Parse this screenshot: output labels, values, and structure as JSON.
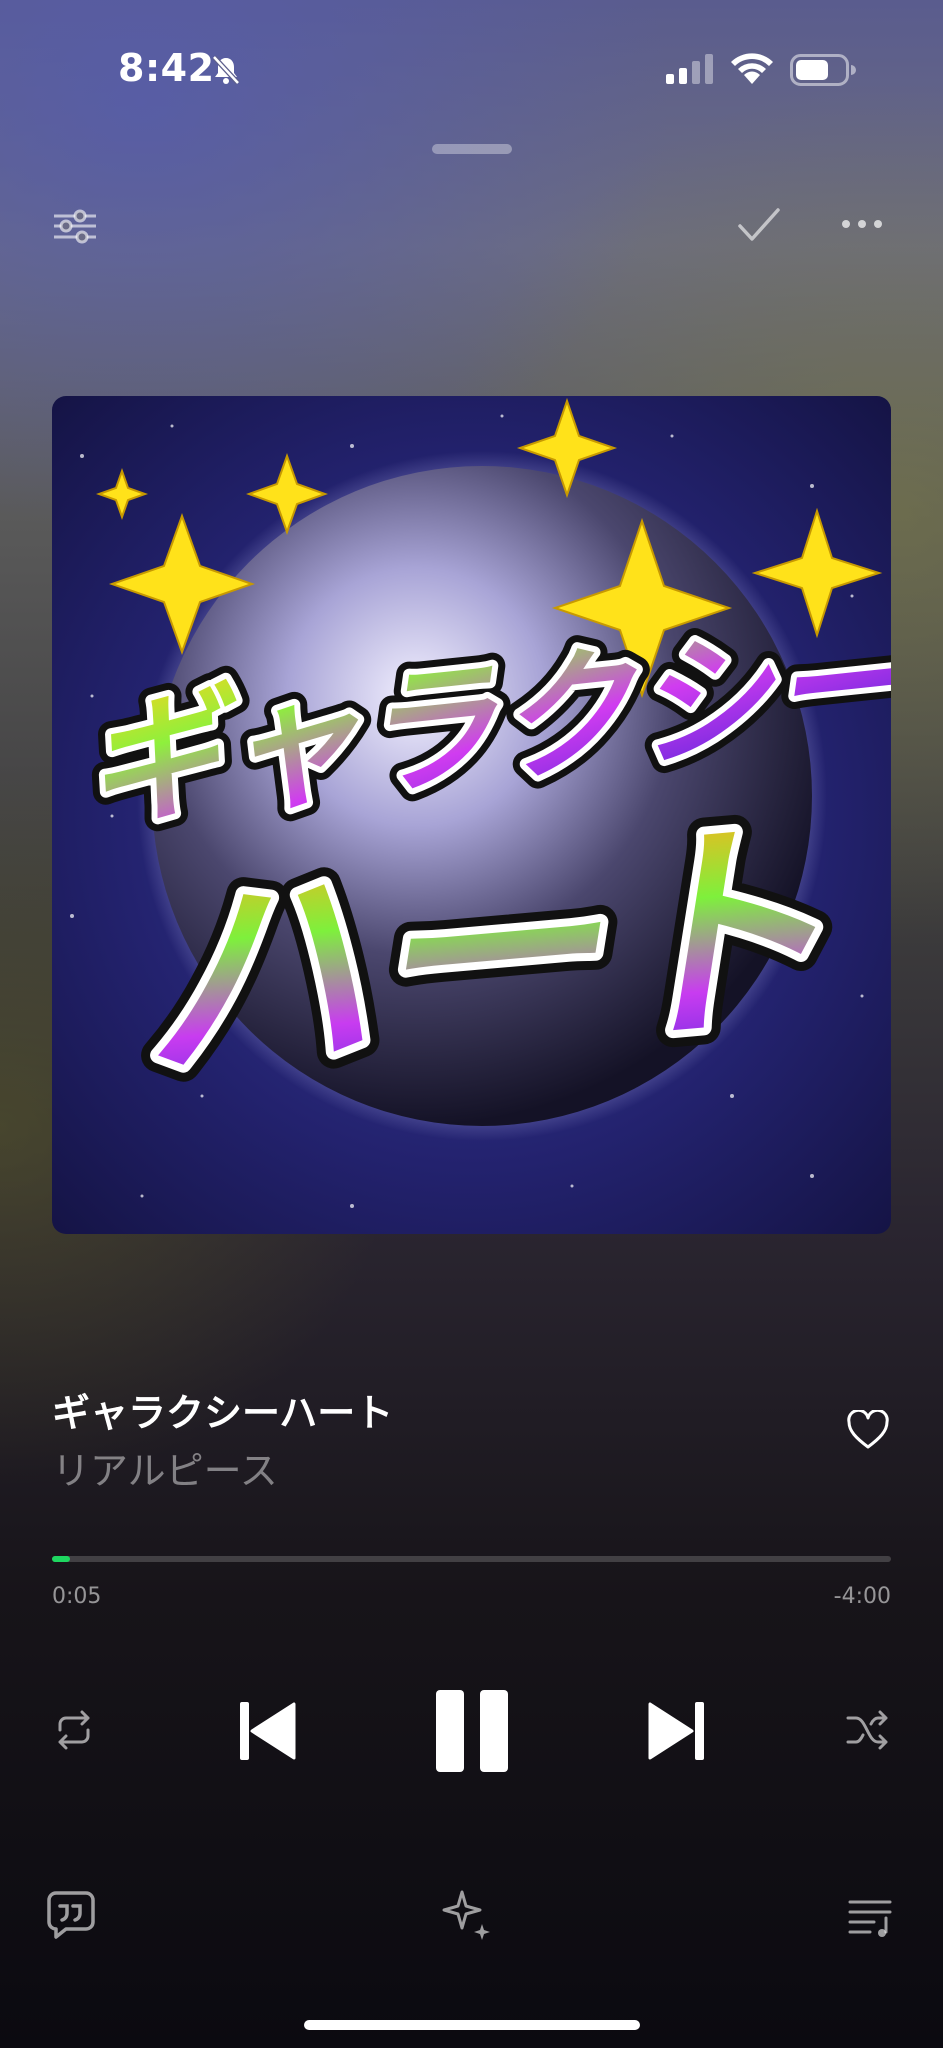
{
  "status_bar": {
    "time": "8:42",
    "icons": [
      "bell-slash-icon",
      "cellular-signal-icon",
      "wifi-icon",
      "battery-icon"
    ]
  },
  "toolbar": {
    "icons": [
      "equalizer-icon",
      "checkmark-icon",
      "more-icon"
    ]
  },
  "artwork": {
    "lettering_line1": "ギャラクシー",
    "lettering_line2": "ハート"
  },
  "track": {
    "title": "ギャラクシーハート",
    "artist": "リアルピース",
    "favorite_icon": "heart-outline-icon"
  },
  "progress": {
    "elapsed": "0:05",
    "remaining": "-4:00",
    "fraction": 0.021
  },
  "controls": {
    "icons": [
      "repeat-icon",
      "previous-track-icon",
      "pause-icon",
      "next-track-icon",
      "shuffle-icon"
    ]
  },
  "bottom_bar": {
    "icons": [
      "lyrics-icon",
      "ai-sparkle-icon",
      "queue-icon"
    ]
  },
  "colors": {
    "accent": "#1ed760",
    "text_primary": "#ffffff",
    "text_secondary": "#8a8790"
  }
}
